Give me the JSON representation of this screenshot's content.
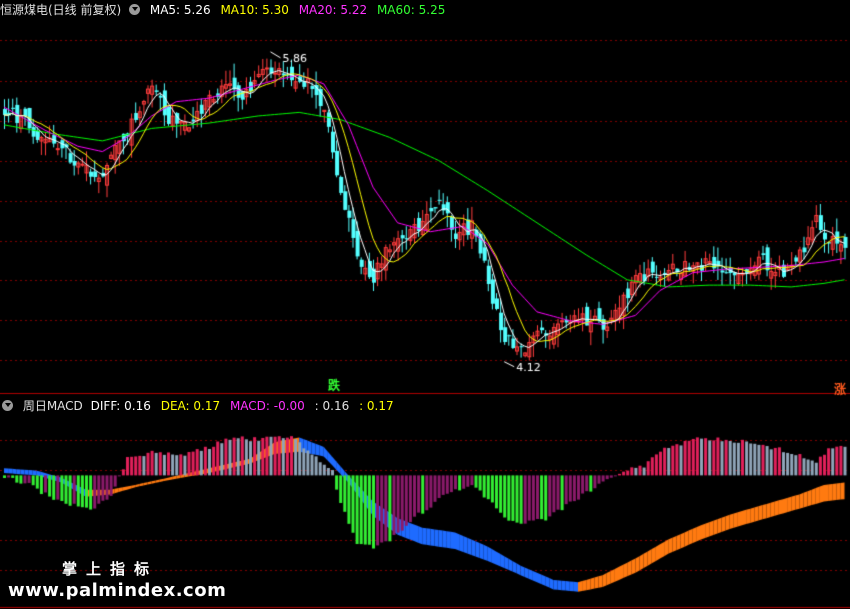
{
  "legend_top": {
    "title": "恒源煤电(日线 前复权)",
    "ma5": "MA5: 5.26",
    "ma10": "MA10: 5.30",
    "ma20": "MA20: 5.22",
    "ma60": "MA60: 5.25"
  },
  "legend_bottom": {
    "title": "周日MACD",
    "diff": "DIFF: 0.16",
    "dea": "DEA: 0.17",
    "macd": "MACD: -0.00",
    "v1": ": 0.16",
    "v2": ": 0.17"
  },
  "annotations": {
    "high": "5.86",
    "low": "4.12",
    "fall_marker": "跌",
    "rise_marker": "涨"
  },
  "watermark": {
    "cn": "掌上指标",
    "url": "www.palmindex.com"
  },
  "colors": {
    "up": "#ff3c3c",
    "down": "#54ffff",
    "ma5": "#ffffff",
    "ma10": "#ffff00",
    "ma20": "#ff00ff",
    "ma60": "#00ff00",
    "hist_pos_a": "#e0205a",
    "hist_pos_b": "#8fa4b8",
    "hist_neg_a": "#33ee33",
    "hist_neg_b": "#8a1a6a",
    "band_blue": "#1e6bff",
    "band_orange": "#ff7a10",
    "grid": "#800000"
  },
  "chart_data": [
    {
      "type": "candlestick",
      "ylim": [
        3.95,
        6.05
      ],
      "ma_current": {
        "MA5": 5.26,
        "MA10": 5.3,
        "MA20": 5.22,
        "MA60": 5.25
      },
      "high_mark": 5.86,
      "low_mark": 4.12,
      "close_path": [
        [
          0,
          5.55
        ],
        [
          8,
          5.4
        ],
        [
          14,
          5.32
        ],
        [
          20,
          5.2
        ],
        [
          24,
          5.15
        ],
        [
          27,
          5.3
        ],
        [
          31,
          5.45
        ],
        [
          36,
          5.65
        ],
        [
          40,
          5.48
        ],
        [
          45,
          5.42
        ],
        [
          50,
          5.58
        ],
        [
          54,
          5.7
        ],
        [
          58,
          5.62
        ],
        [
          62,
          5.72
        ],
        [
          66,
          5.75
        ],
        [
          70,
          5.7
        ],
        [
          75,
          5.68
        ],
        [
          78,
          5.5
        ],
        [
          82,
          5.1
        ],
        [
          86,
          4.7
        ],
        [
          89,
          4.55
        ],
        [
          93,
          4.75
        ],
        [
          98,
          4.82
        ],
        [
          102,
          4.9
        ],
        [
          106,
          5.05
        ],
        [
          110,
          4.8
        ],
        [
          114,
          4.9
        ],
        [
          117,
          4.65
        ],
        [
          121,
          4.3
        ],
        [
          124,
          4.22
        ],
        [
          127,
          4.2
        ],
        [
          132,
          4.28
        ],
        [
          136,
          4.35
        ],
        [
          141,
          4.38
        ],
        [
          146,
          4.32
        ],
        [
          150,
          4.45
        ],
        [
          155,
          4.6
        ],
        [
          160,
          4.62
        ],
        [
          165,
          4.65
        ],
        [
          170,
          4.66
        ],
        [
          175,
          4.64
        ],
        [
          180,
          4.65
        ],
        [
          185,
          4.68
        ],
        [
          190,
          4.62
        ],
        [
          194,
          4.72
        ],
        [
          198,
          4.9
        ],
        [
          201,
          4.8
        ],
        [
          205,
          4.75
        ]
      ],
      "ma20_path": [
        [
          0,
          5.55
        ],
        [
          10,
          5.42
        ],
        [
          18,
          5.33
        ],
        [
          24,
          5.3
        ],
        [
          30,
          5.38
        ],
        [
          36,
          5.5
        ],
        [
          42,
          5.58
        ],
        [
          50,
          5.6
        ],
        [
          58,
          5.65
        ],
        [
          66,
          5.7
        ],
        [
          72,
          5.73
        ],
        [
          78,
          5.68
        ],
        [
          84,
          5.45
        ],
        [
          90,
          5.1
        ],
        [
          96,
          4.9
        ],
        [
          104,
          4.85
        ],
        [
          112,
          4.88
        ],
        [
          118,
          4.78
        ],
        [
          124,
          4.55
        ],
        [
          130,
          4.4
        ],
        [
          138,
          4.35
        ],
        [
          146,
          4.33
        ],
        [
          154,
          4.38
        ],
        [
          160,
          4.52
        ],
        [
          168,
          4.62
        ],
        [
          176,
          4.64
        ],
        [
          184,
          4.65
        ],
        [
          192,
          4.66
        ],
        [
          200,
          4.68
        ],
        [
          205,
          4.7
        ]
      ],
      "ma60_path": [
        [
          0,
          5.45
        ],
        [
          12,
          5.4
        ],
        [
          24,
          5.36
        ],
        [
          36,
          5.43
        ],
        [
          50,
          5.46
        ],
        [
          62,
          5.5
        ],
        [
          72,
          5.52
        ],
        [
          82,
          5.48
        ],
        [
          94,
          5.38
        ],
        [
          106,
          5.25
        ],
        [
          118,
          5.08
        ],
        [
          130,
          4.9
        ],
        [
          142,
          4.72
        ],
        [
          152,
          4.58
        ],
        [
          162,
          4.54
        ],
        [
          172,
          4.55
        ],
        [
          182,
          4.55
        ],
        [
          192,
          4.54
        ],
        [
          200,
          4.56
        ],
        [
          205,
          4.58
        ]
      ]
    },
    {
      "type": "macd",
      "DIFF": 0.16,
      "DEA": 0.17,
      "MACD": -0.0,
      "ylim": [
        -0.55,
        0.25
      ],
      "histogram_path": [
        [
          0,
          -0.01
        ],
        [
          5,
          -0.03
        ],
        [
          10,
          -0.08
        ],
        [
          16,
          -0.12
        ],
        [
          22,
          -0.14
        ],
        [
          26,
          -0.08
        ],
        [
          30,
          0.07
        ],
        [
          36,
          0.1
        ],
        [
          42,
          0.08
        ],
        [
          50,
          0.12
        ],
        [
          56,
          0.16
        ],
        [
          62,
          0.15
        ],
        [
          66,
          0.17
        ],
        [
          70,
          0.16
        ],
        [
          76,
          0.08
        ],
        [
          80,
          0.02
        ],
        [
          82,
          -0.12
        ],
        [
          86,
          -0.28
        ],
        [
          90,
          -0.3
        ],
        [
          94,
          -0.27
        ],
        [
          100,
          -0.18
        ],
        [
          106,
          -0.1
        ],
        [
          110,
          -0.06
        ],
        [
          114,
          -0.04
        ],
        [
          118,
          -0.1
        ],
        [
          122,
          -0.18
        ],
        [
          126,
          -0.2
        ],
        [
          132,
          -0.18
        ],
        [
          138,
          -0.12
        ],
        [
          144,
          -0.05
        ],
        [
          150,
          0.01
        ],
        [
          156,
          0.04
        ],
        [
          162,
          0.12
        ],
        [
          168,
          0.15
        ],
        [
          176,
          0.15
        ],
        [
          184,
          0.13
        ],
        [
          192,
          0.1
        ],
        [
          198,
          0.06
        ],
        [
          202,
          0.12
        ],
        [
          205,
          0.12
        ]
      ],
      "band_upper_path": [
        [
          0,
          0.03
        ],
        [
          8,
          0.02
        ],
        [
          14,
          -0.01
        ],
        [
          20,
          -0.06
        ],
        [
          26,
          -0.06
        ],
        [
          32,
          -0.04
        ],
        [
          40,
          -0.01
        ],
        [
          50,
          0.03
        ],
        [
          60,
          0.07
        ],
        [
          66,
          0.14
        ],
        [
          72,
          0.16
        ],
        [
          78,
          0.12
        ],
        [
          84,
          0.0
        ],
        [
          90,
          -0.11
        ],
        [
          96,
          -0.18
        ],
        [
          102,
          -0.22
        ],
        [
          110,
          -0.24
        ],
        [
          118,
          -0.3
        ],
        [
          126,
          -0.38
        ],
        [
          134,
          -0.44
        ],
        [
          140,
          -0.45
        ],
        [
          146,
          -0.42
        ],
        [
          154,
          -0.35
        ],
        [
          162,
          -0.27
        ],
        [
          170,
          -0.21
        ],
        [
          178,
          -0.16
        ],
        [
          186,
          -0.12
        ],
        [
          194,
          -0.08
        ],
        [
          200,
          -0.04
        ],
        [
          205,
          -0.03
        ]
      ],
      "band_lower_path": [
        [
          0,
          0.01
        ],
        [
          8,
          0.0
        ],
        [
          14,
          -0.03
        ],
        [
          20,
          -0.09
        ],
        [
          26,
          -0.08
        ],
        [
          32,
          -0.05
        ],
        [
          40,
          -0.02
        ],
        [
          50,
          0.01
        ],
        [
          60,
          0.05
        ],
        [
          66,
          0.09
        ],
        [
          72,
          0.1
        ],
        [
          78,
          0.08
        ],
        [
          84,
          -0.03
        ],
        [
          90,
          -0.17
        ],
        [
          96,
          -0.25
        ],
        [
          102,
          -0.29
        ],
        [
          110,
          -0.31
        ],
        [
          118,
          -0.36
        ],
        [
          126,
          -0.42
        ],
        [
          134,
          -0.48
        ],
        [
          140,
          -0.49
        ],
        [
          146,
          -0.47
        ],
        [
          154,
          -0.41
        ],
        [
          162,
          -0.33
        ],
        [
          170,
          -0.27
        ],
        [
          178,
          -0.22
        ],
        [
          186,
          -0.18
        ],
        [
          194,
          -0.14
        ],
        [
          200,
          -0.11
        ],
        [
          205,
          -0.1
        ]
      ]
    }
  ]
}
